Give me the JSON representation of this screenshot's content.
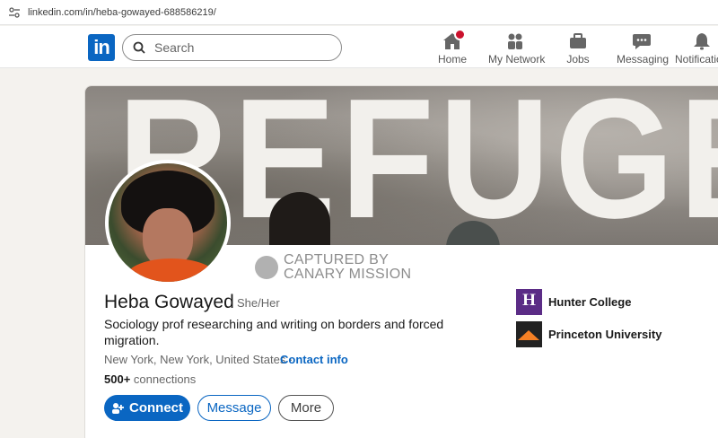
{
  "browser": {
    "url": "linkedin.com/in/heba-gowayed-688586219/"
  },
  "nav": {
    "logo": "in",
    "search_placeholder": "Search",
    "items": [
      {
        "label": "Home",
        "icon": "home-icon"
      },
      {
        "label": "My Network",
        "icon": "network-icon"
      },
      {
        "label": "Jobs",
        "icon": "briefcase-icon"
      },
      {
        "label": "Messaging",
        "icon": "chat-icon"
      },
      {
        "label": "Notifications",
        "icon": "bell-icon"
      }
    ]
  },
  "banner": {
    "text": "REFUGE"
  },
  "watermark": {
    "line1": "CAPTURED BY",
    "line2": "CANARY MISSION"
  },
  "profile": {
    "name": "Heba Gowayed",
    "pronouns": "She/Her",
    "headline": "Sociology prof researching and writing on borders and forced migration.",
    "location": "New York, New York, United States ·",
    "contact_info": "Contact info",
    "connections": "500+",
    "connections_suffix": " connections"
  },
  "actions": {
    "connect": "Connect",
    "message": "Message",
    "more": "More"
  },
  "organizations": [
    {
      "name": "Hunter College",
      "logo_text": "H"
    },
    {
      "name": "Princeton University"
    }
  ],
  "colors": {
    "brand": "#0a66c2",
    "notification_badge": "#cb112d",
    "hunter": "#5b2c86",
    "princeton": "#f58025"
  }
}
